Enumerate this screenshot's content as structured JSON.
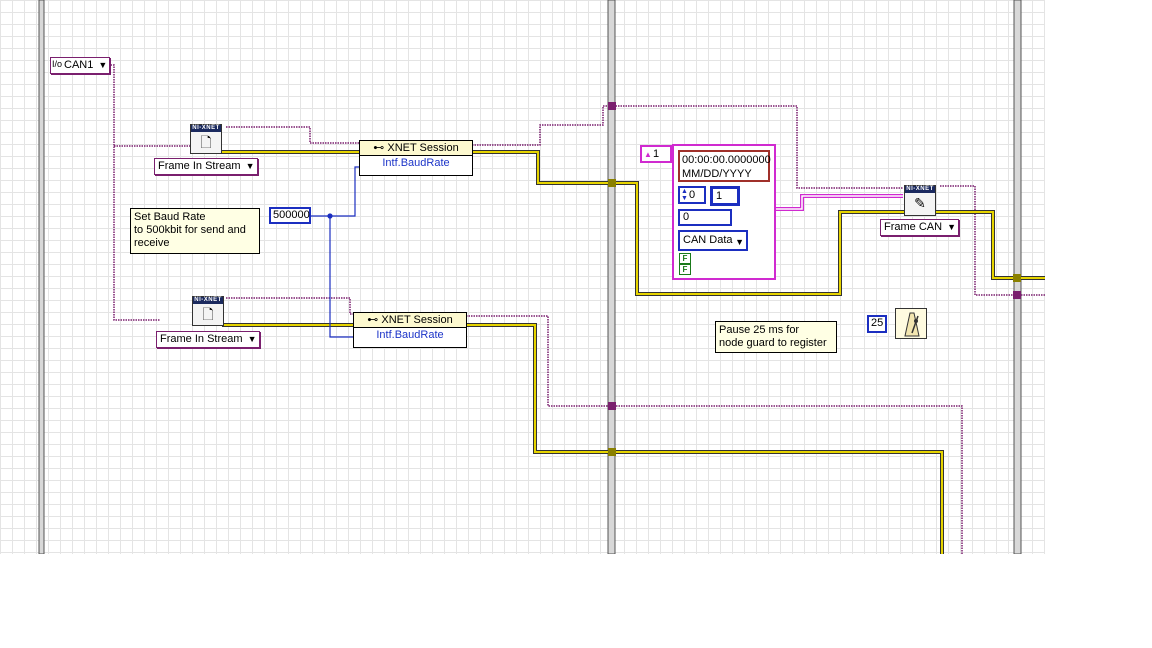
{
  "can_interface": "CAN1",
  "create_session_1": {
    "mode": "Frame In Stream",
    "icon_label": "NI-XNET"
  },
  "create_session_2": {
    "mode": "Frame In Stream",
    "icon_label": "NI-XNET"
  },
  "property_node_1": {
    "header": "XNET Session",
    "property": "Intf.BaudRate"
  },
  "property_node_2": {
    "header": "XNET Session",
    "property": "Intf.BaudRate"
  },
  "baud_rate_constant": "500000",
  "baud_comment": "Set Baud Rate\nto 500kbit for send and\nreceive",
  "frame_cluster": {
    "array_index": "1",
    "timestamp": "00:00:00.0000000",
    "date_format": "MM/DD/YYYY",
    "identifier": "0",
    "length": "1",
    "extended_field": "0",
    "type": "CAN Data",
    "bool_1": "F",
    "bool_2": "F"
  },
  "write_node": {
    "mode": "Frame CAN",
    "icon_label": "NI-XNET"
  },
  "pause_comment": "Pause 25 ms for\nnode guard to register",
  "wait_constant": "25",
  "colors": {
    "refnum_wire": "#7a1f6e",
    "session_wire": "#b8a000",
    "numeric_wire": "#1b2ec0",
    "cluster_wire": "#d02ad0"
  }
}
